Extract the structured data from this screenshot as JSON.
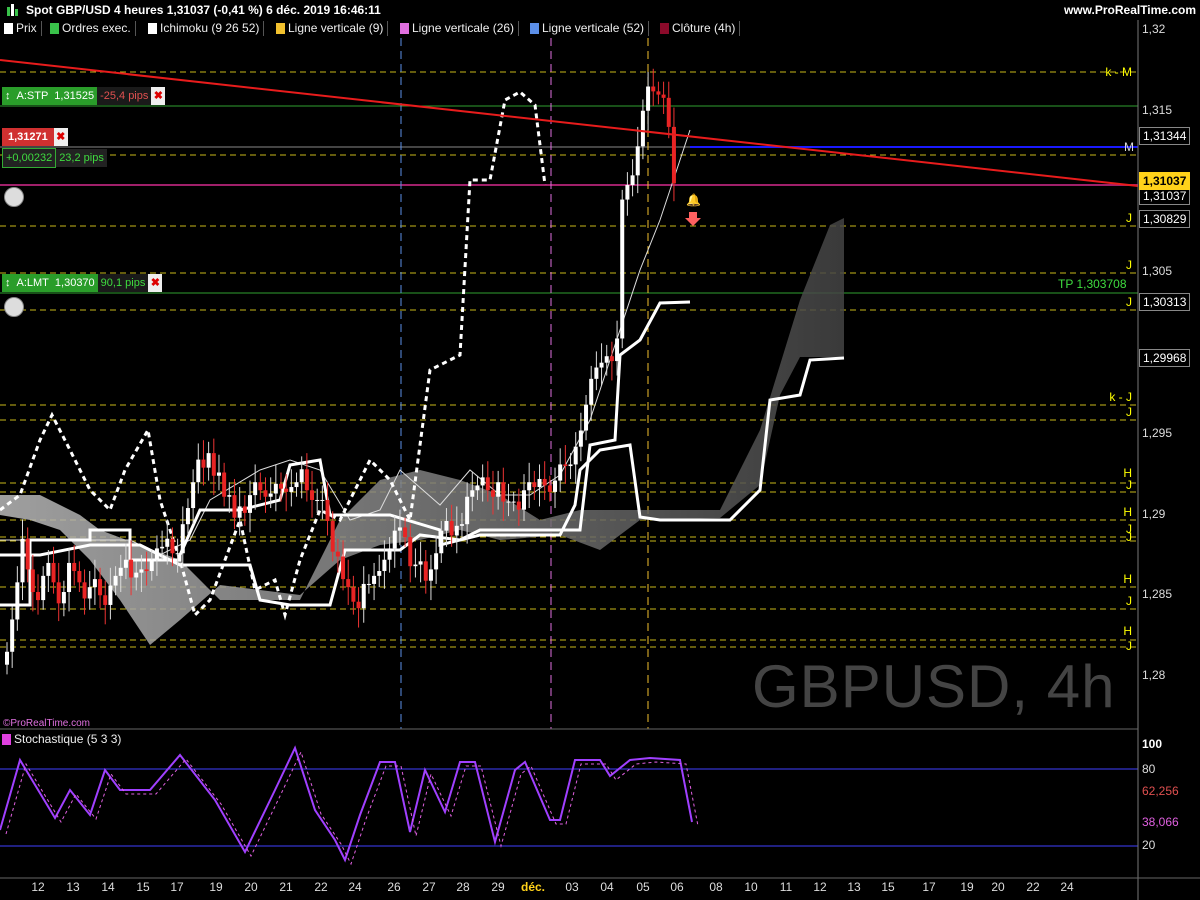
{
  "header": {
    "title": "Spot GBP/USD 4 heures 1,31037 (-0,41 %) 6 déc. 2019 16:46:11",
    "brand": "www.ProRealTime.com"
  },
  "legend": [
    {
      "label": "Prix",
      "color": "#ffffff"
    },
    {
      "label": "Ordres exec.",
      "color": "#39c24a"
    },
    {
      "label": "Ichimoku (9 26 52)",
      "color": "#ffffff"
    },
    {
      "label": "Ligne verticale (9)",
      "color": "#f2c12e"
    },
    {
      "label": "Ligne verticale (26)",
      "color": "#e070e0"
    },
    {
      "label": "Ligne verticale (52)",
      "color": "#5c8fe8"
    },
    {
      "label": "Clôture (4h)",
      "color": "#8b0a2a"
    }
  ],
  "orders": {
    "stp": {
      "label": "A:STP",
      "price": "1,31525",
      "pips": "-25,4 pips"
    },
    "pos": {
      "price": "1,31271",
      "pnl": "+0,00232",
      "pips": "23,2 pips"
    },
    "lmt": {
      "label": "A:LMT",
      "price": "1,30370",
      "pips": "90,1 pips"
    },
    "tp": "TP 1,303708"
  },
  "price_axis": {
    "ticks": [
      "1,32",
      "1,315",
      "1,31",
      "1,305",
      "1,3",
      "1,295",
      "1,29",
      "1,285",
      "1,28"
    ],
    "tags": [
      "1,31344",
      "1,31037",
      "1,31037",
      "1,30829",
      "1,30313",
      "1,29968"
    ]
  },
  "levels": [
    "k - M",
    "M",
    "J",
    "J",
    "J",
    "k - J",
    "J",
    "H",
    "J",
    "H",
    "J",
    "J",
    "H",
    "J",
    "H",
    "J"
  ],
  "watermark": "GBPUSD, 4h",
  "credit": "©ProRealTime.com",
  "stoch": {
    "label": "Stochastique (5 3 3)",
    "ticks": [
      "100",
      "80",
      "20"
    ],
    "tags": [
      "62,256",
      "38,066"
    ]
  },
  "x_axis": [
    "12",
    "13",
    "14",
    "15",
    "17",
    "19",
    "20",
    "21",
    "22",
    "24",
    "26",
    "27",
    "28",
    "29",
    "déc.",
    "03",
    "04",
    "05",
    "06",
    "08",
    "10",
    "11",
    "12",
    "13",
    "15",
    "17",
    "19",
    "20",
    "22",
    "24"
  ],
  "chart_data": {
    "type": "candlestick",
    "title": "Spot GBP/USD 4 heures",
    "ylim": [
      1.278,
      1.32
    ],
    "close": [
      1.2815,
      1.2835,
      1.2858,
      1.2885,
      1.2866,
      1.2852,
      1.2847,
      1.2862,
      1.287,
      1.2858,
      1.2845,
      1.2852,
      1.287,
      1.2865,
      1.2858,
      1.2848,
      1.2855,
      1.286,
      1.285,
      1.2844,
      1.2856,
      1.2862,
      1.2867,
      1.2872,
      1.2861,
      1.2864,
      1.2866,
      1.2865,
      1.2872,
      1.2879,
      1.288,
      1.2885,
      1.2876,
      1.2876,
      1.2894,
      1.2904,
      1.292,
      1.2934,
      1.2929,
      1.2938,
      1.2924,
      1.2926,
      1.2911,
      1.2912,
      1.2898,
      1.2905,
      1.2901,
      1.2912,
      1.292,
      1.2915,
      1.2911,
      1.2913,
      1.2919,
      1.2916,
      1.2914,
      1.2917,
      1.292,
      1.2928,
      1.2915,
      1.2909,
      1.2909,
      1.2909,
      1.2896,
      1.2877,
      1.2874,
      1.286,
      1.2855,
      1.2846,
      1.2842,
      1.2857,
      1.2857,
      1.2862,
      1.2865,
      1.2872,
      1.2879,
      1.289,
      1.2892,
      1.2886,
      1.2868,
      1.2869,
      1.2871,
      1.2859,
      1.2866,
      1.2876,
      1.289,
      1.2896,
      1.2887,
      1.2893,
      1.2894,
      1.2911,
      1.2915,
      1.2918,
      1.2923,
      1.2915,
      1.2911,
      1.292,
      1.2908,
      1.2908,
      1.2908,
      1.2903,
      1.2915,
      1.292,
      1.2917,
      1.2922,
      1.2918,
      1.2914,
      1.2921,
      1.2931,
      1.293,
      1.2931,
      1.2942,
      1.2952,
      1.2968,
      1.2984,
      1.2991,
      1.2994,
      1.2998,
      1.2995,
      1.3009,
      1.3095,
      1.3104,
      1.311,
      1.3128,
      1.315,
      1.3165,
      1.3162,
      1.316,
      1.3158,
      1.314,
      1.3105
    ],
    "ichimoku": {
      "periods": [
        9,
        26,
        52
      ]
    },
    "vertical_lines": [
      "Ligne verticale (9)",
      "Ligne verticale (26)",
      "Ligne verticale (52)"
    ]
  }
}
